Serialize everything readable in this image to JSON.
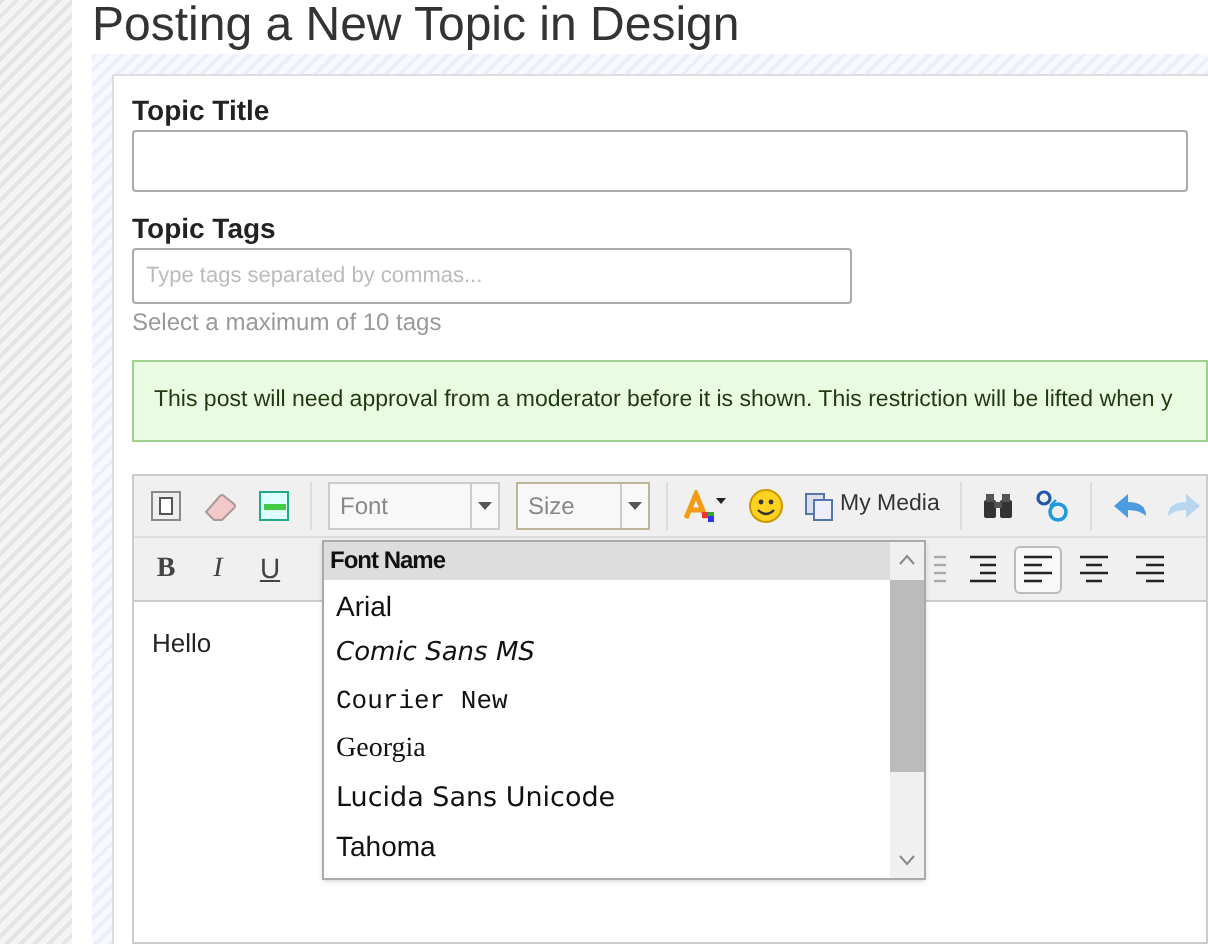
{
  "page_title": "Posting a New Topic in Design",
  "topic_title": {
    "label": "Topic Title"
  },
  "topic_tags": {
    "label": "Topic Tags",
    "placeholder": "Type tags separated by commas...",
    "hint": "Select a maximum of 10 tags"
  },
  "notice": "This post will need approval from a moderator before it is shown. This restriction will be lifted when y",
  "editor": {
    "font_select": "Font",
    "size_select": "Size",
    "media_button": "My Media",
    "format_buttons": [
      {
        "kind": "bold",
        "label": "B"
      },
      {
        "kind": "italic",
        "label": "I"
      },
      {
        "kind": "underline",
        "label": "U"
      }
    ],
    "align_buttons": [
      {
        "kind": "indent-less",
        "selected": false
      },
      {
        "kind": "indent-more",
        "selected": false
      },
      {
        "kind": "left",
        "selected": true
      },
      {
        "kind": "center",
        "selected": false
      },
      {
        "kind": "right",
        "selected": false
      }
    ],
    "content": "Hello",
    "font_menu": {
      "header": "Font Name",
      "items": [
        {
          "label": "Arial",
          "kind": "sans"
        },
        {
          "label": "Comic Sans MS",
          "kind": "script"
        },
        {
          "label": "Courier New",
          "kind": "mono"
        },
        {
          "label": "Georgia",
          "kind": "serif"
        },
        {
          "label": "Lucida Sans Unicode",
          "kind": "humanist"
        },
        {
          "label": "Tahoma",
          "kind": "sans"
        }
      ]
    }
  }
}
